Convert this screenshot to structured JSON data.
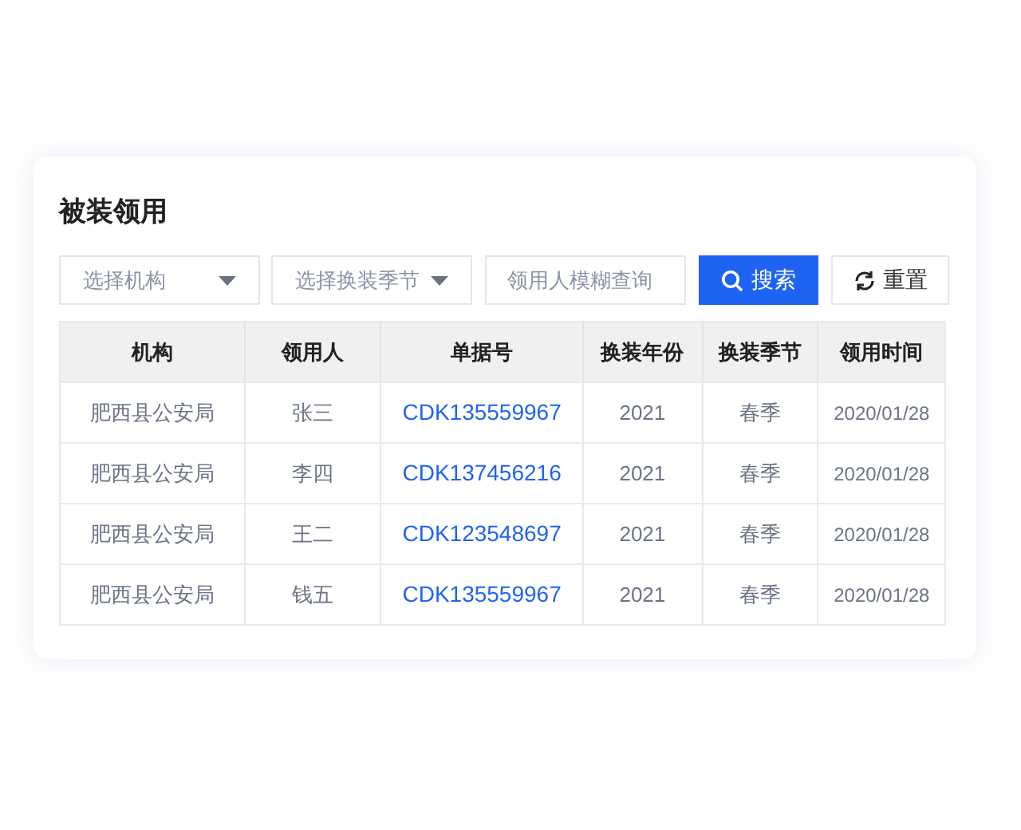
{
  "title": "被装领用",
  "filters": {
    "org_select": {
      "placeholder": "选择机构"
    },
    "season_select": {
      "placeholder": "选择换装季节"
    },
    "name_search": {
      "placeholder": "领用人模糊查询"
    }
  },
  "buttons": {
    "search": {
      "label": "搜索"
    },
    "reset": {
      "label": "重置"
    }
  },
  "table": {
    "columns": [
      "机构",
      "领用人",
      "单据号",
      "换装年份",
      "换装季节",
      "领用时间"
    ],
    "rows": [
      {
        "org": "肥西县公安局",
        "person": "张三",
        "doc": "CDK135559967",
        "year": "2021",
        "season": "春季",
        "time": "2020/01/28"
      },
      {
        "org": "肥西县公安局",
        "person": "李四",
        "doc": "CDK137456216",
        "year": "2021",
        "season": "春季",
        "time": "2020/01/28"
      },
      {
        "org": "肥西县公安局",
        "person": "王二",
        "doc": "CDK123548697",
        "year": "2021",
        "season": "春季",
        "time": "2020/01/28"
      },
      {
        "org": "肥西县公安局",
        "person": "钱五",
        "doc": "CDK135559967",
        "year": "2021",
        "season": "春季",
        "time": "2020/01/28"
      }
    ]
  }
}
